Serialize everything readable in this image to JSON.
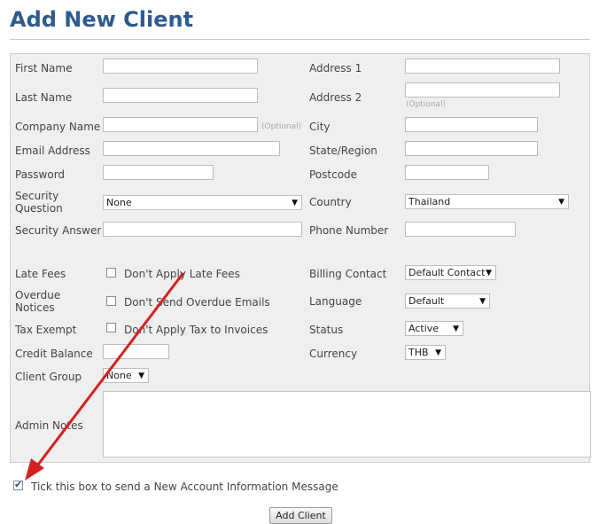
{
  "page": {
    "title": "Add New Client"
  },
  "form": {
    "first_name": {
      "label": "First Name",
      "value": ""
    },
    "last_name": {
      "label": "Last Name",
      "value": ""
    },
    "company_name": {
      "label": "Company Name",
      "value": "",
      "hint": "(Optional)"
    },
    "email": {
      "label": "Email Address",
      "value": ""
    },
    "password": {
      "label": "Password",
      "value": ""
    },
    "security_question": {
      "label": "Security Question",
      "value": "None"
    },
    "security_answer": {
      "label": "Security Answer",
      "value": ""
    },
    "address1": {
      "label": "Address 1",
      "value": ""
    },
    "address2": {
      "label": "Address 2",
      "value": "",
      "hint": "(Optional)"
    },
    "city": {
      "label": "City",
      "value": ""
    },
    "state": {
      "label": "State/Region",
      "value": ""
    },
    "postcode": {
      "label": "Postcode",
      "value": ""
    },
    "country": {
      "label": "Country",
      "value": "Thailand"
    },
    "phone": {
      "label": "Phone Number",
      "value": ""
    },
    "late_fees": {
      "label": "Late Fees",
      "checkbox_label": "Don't Apply Late Fees",
      "checked": false
    },
    "overdue_notices": {
      "label": "Overdue Notices",
      "checkbox_label": "Don't Send Overdue Emails",
      "checked": false
    },
    "tax_exempt": {
      "label": "Tax Exempt",
      "checkbox_label": "Don't Apply Tax to Invoices",
      "checked": false
    },
    "credit_balance": {
      "label": "Credit Balance",
      "value": ""
    },
    "client_group": {
      "label": "Client Group",
      "value": "None"
    },
    "billing_contact": {
      "label": "Billing Contact",
      "value": "Default Contact"
    },
    "language": {
      "label": "Language",
      "value": "Default"
    },
    "status": {
      "label": "Status",
      "value": "Active"
    },
    "currency": {
      "label": "Currency",
      "value": "THB"
    },
    "admin_notes": {
      "label": "Admin Notes",
      "value": ""
    }
  },
  "send_message": {
    "label": "Tick this box to send a New Account Information Message",
    "checked": true
  },
  "submit": {
    "label": "Add Client"
  },
  "colors": {
    "title": "#2e5b8f",
    "panel": "#efefef",
    "arrow": "#d42020"
  },
  "icons": {
    "dropdown": "▼",
    "annotation": "red-arrow"
  }
}
